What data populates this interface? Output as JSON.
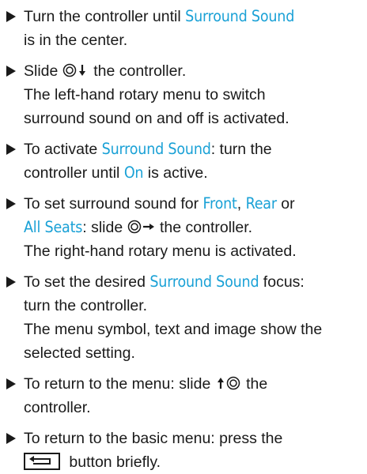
{
  "steps": [
    {
      "parts": [
        "Turn the controller until ",
        "Surround Sound",
        "is in the center."
      ]
    },
    {
      "parts": [
        "Slide ",
        " the controller.",
        "The left-hand rotary menu to switch",
        "surround sound on and off is activated."
      ]
    },
    {
      "parts": [
        "To activate ",
        "Surround Sound",
        ": turn the",
        "controller until ",
        "On",
        " is active."
      ]
    },
    {
      "parts": [
        "To set surround sound for ",
        "Front",
        ", ",
        "Rear",
        " or",
        "All Seats",
        ": slide ",
        " the controller.",
        "The right-hand rotary menu is activated."
      ]
    },
    {
      "parts": [
        "To set the desired ",
        "Surround Sound",
        " focus:",
        "turn the controller.",
        "The menu symbol, text and image show the",
        "selected setting."
      ]
    },
    {
      "parts": [
        "To return to the menu: slide ",
        " the",
        "controller."
      ]
    },
    {
      "parts": [
        "To return to the basic menu: press the",
        " button briefly."
      ]
    }
  ],
  "icons": {
    "bullet": "triangle-right-icon",
    "controller_down": "controller-slide-down-icon",
    "controller_right": "controller-slide-right-icon",
    "controller_up": "controller-slide-up-icon",
    "back_button": "back-button-icon"
  },
  "colors": {
    "highlight": "#1aa1d6",
    "text": "#1a1a1a"
  }
}
